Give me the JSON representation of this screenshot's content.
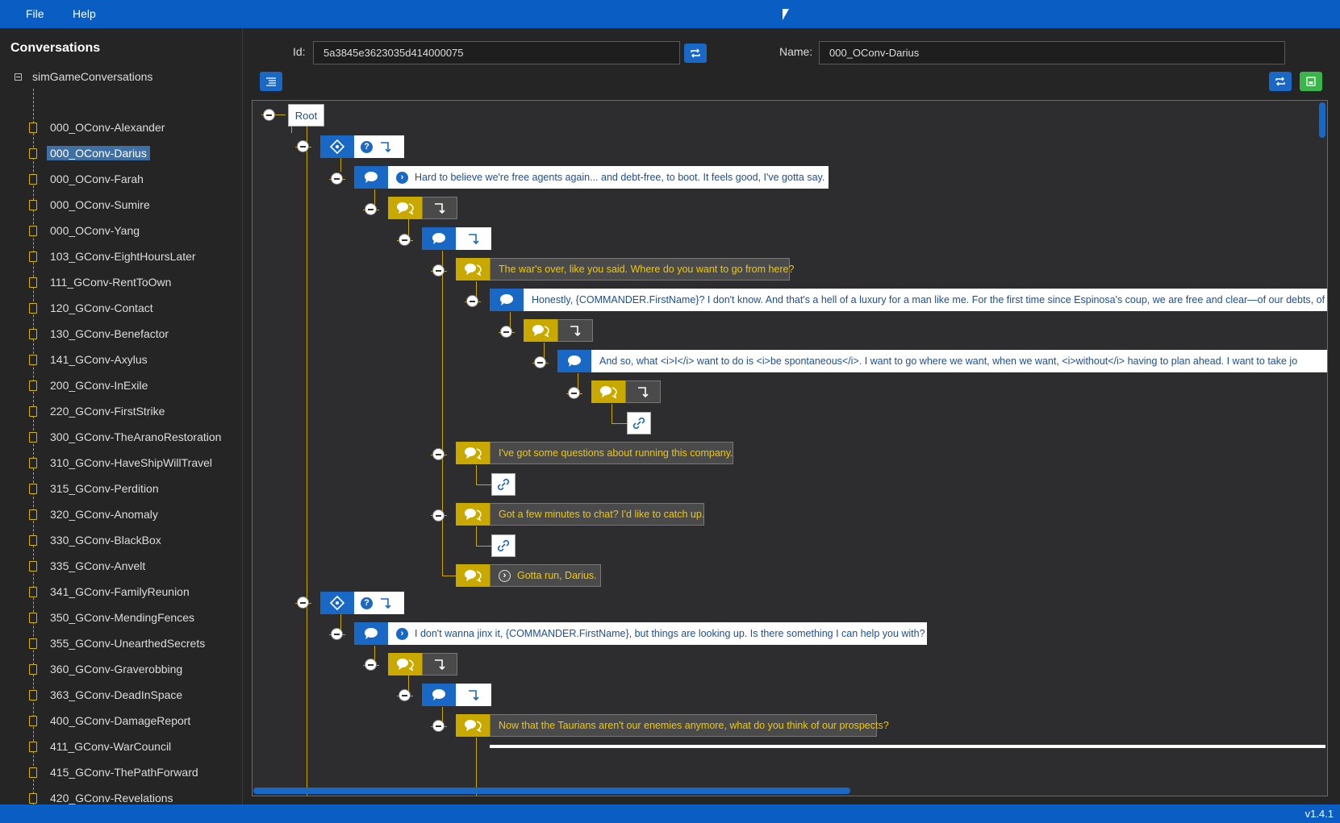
{
  "menu": {
    "file": "File",
    "help": "Help"
  },
  "sidebar": {
    "title": "Conversations",
    "root_label": "simGameConversations",
    "items": [
      {
        "label": "000_OConv-Alexander"
      },
      {
        "label": "000_OConv-Darius",
        "selected": true
      },
      {
        "label": "000_OConv-Farah"
      },
      {
        "label": "000_OConv-Sumire"
      },
      {
        "label": "000_OConv-Yang"
      },
      {
        "label": "103_GConv-EightHoursLater"
      },
      {
        "label": "111_GConv-RentToOwn"
      },
      {
        "label": "120_GConv-Contact"
      },
      {
        "label": "130_GConv-Benefactor"
      },
      {
        "label": "141_GConv-Axylus"
      },
      {
        "label": "200_GConv-InExile"
      },
      {
        "label": "220_GConv-FirstStrike"
      },
      {
        "label": "300_GConv-TheAranoRestoration"
      },
      {
        "label": "310_GConv-HaveShipWillTravel"
      },
      {
        "label": "315_GConv-Perdition"
      },
      {
        "label": "320_GConv-Anomaly"
      },
      {
        "label": "330_GConv-BlackBox"
      },
      {
        "label": "335_GConv-Anvelt"
      },
      {
        "label": "341_GConv-FamilyReunion"
      },
      {
        "label": "350_GConv-MendingFences"
      },
      {
        "label": "355_GConv-UnearthedSecrets"
      },
      {
        "label": "360_GConv-Graverobbing"
      },
      {
        "label": "363_GConv-DeadInSpace"
      },
      {
        "label": "400_GConv-DamageReport"
      },
      {
        "label": "411_GConv-WarCouncil"
      },
      {
        "label": "415_GConv-ThePathForward"
      },
      {
        "label": "420_GConv-Revelations"
      }
    ]
  },
  "editor": {
    "id_label": "Id:",
    "id_value": "5a3845e3623035d414000075",
    "name_label": "Name:",
    "name_value": "000_OConv-Darius"
  },
  "tree": {
    "root_label": "Root",
    "line1": "Hard to believe we're free agents again... and debt-free, to boot. It feels good, I've gotta say.",
    "line2": "The war's over, like you said. Where do you want to go from here?",
    "line3": "Honestly, {COMMANDER.FirstName}? I don't know. And that's a hell of a luxury for a man like me. For the first time since Espinosa's coup, we are free and clear—of our debts, of",
    "line4": "And so, what <i>I</i> want to do is <i>be spontaneous</i>. I want to go where we want, when we want, <i>without</i> having to plan ahead. I want to take jo",
    "line5": "I've got some questions about running this company.",
    "line6": "Got a few minutes to chat? I'd like to catch up.",
    "line7": "Gotta run, Darius.",
    "line8": "I don't wanna jinx it, {COMMANDER.FirstName}, but things are looking up. Is there something I can help you with?",
    "line9": "Now that the Taurians aren't our enemies anymore, what do you think of our prospects?"
  },
  "status": {
    "version": "v1.4.1"
  },
  "colors": {
    "accent": "#0a5dc2",
    "gold": "#c9a800",
    "save": "#39b54a"
  }
}
